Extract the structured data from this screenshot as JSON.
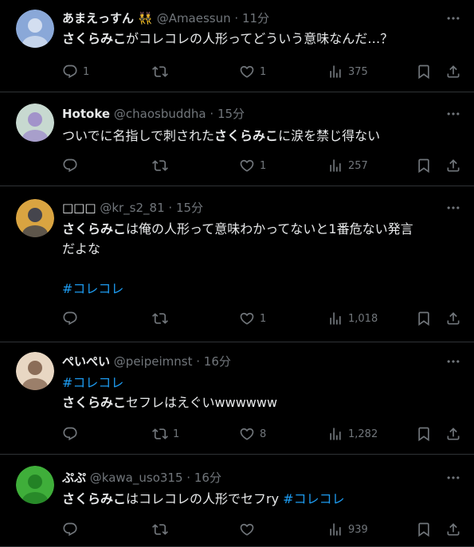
{
  "tweets": [
    {
      "name": "あまえっすん 👯",
      "handle": "@Amaessun",
      "sep": "·",
      "time": "11分",
      "body_parts": [
        {
          "t": "さくらみこ",
          "k": "hl"
        },
        {
          "t": "がコレコレの人形ってどういう意味なんだ…？",
          "k": ""
        }
      ],
      "replies": "1",
      "retweets": "",
      "likes": "1",
      "views": "375",
      "avatar_colors": [
        "#8aa8d8",
        "#dfe8f5"
      ]
    },
    {
      "name": "Hotoke",
      "handle": "@chaosbuddha",
      "sep": "·",
      "time": "15分",
      "body_parts": [
        {
          "t": "ついでに名指しで刺された",
          "k": ""
        },
        {
          "t": "さくらみこ",
          "k": "hl"
        },
        {
          "t": "に涙を禁じ得ない",
          "k": ""
        }
      ],
      "replies": "",
      "retweets": "",
      "likes": "1",
      "views": "257",
      "avatar_colors": [
        "#c7d9d0",
        "#9b86c9"
      ]
    },
    {
      "name": "□□□",
      "handle": "@kr_s2_81",
      "sep": "·",
      "time": "15分",
      "body_parts": [
        {
          "t": "さくらみこ",
          "k": "hl"
        },
        {
          "t": "は俺の人形って意味わかってないと1番危ない発言\nだよな\n\n",
          "k": ""
        },
        {
          "t": "#コレコレ",
          "k": "tag"
        }
      ],
      "replies": "",
      "retweets": "",
      "likes": "1",
      "views": "1,018",
      "avatar_colors": [
        "#d9a441",
        "#2a3550"
      ]
    },
    {
      "name": "ぺいぺい",
      "handle": "@peipeimnst",
      "sep": "·",
      "time": "16分",
      "body_parts": [
        {
          "t": "#コレコレ",
          "k": "tag"
        },
        {
          "t": "\n",
          "k": ""
        },
        {
          "t": "さくらみこ",
          "k": "hl"
        },
        {
          "t": "セフレはえぐいwwwwww",
          "k": ""
        }
      ],
      "replies": "",
      "retweets": "1",
      "likes": "8",
      "views": "1,282",
      "avatar_colors": [
        "#e8d7c3",
        "#7a5a45"
      ]
    },
    {
      "name": "ぷぷ",
      "handle": "@kawa_uso315",
      "sep": "·",
      "time": "16分",
      "body_parts": [
        {
          "t": "さくらみこ",
          "k": "hl"
        },
        {
          "t": "はコレコレの人形でセフry ",
          "k": ""
        },
        {
          "t": "#コレコレ",
          "k": "tag"
        }
      ],
      "replies": "",
      "retweets": "",
      "likes": "",
      "views": "939",
      "avatar_colors": [
        "#3fae3a",
        "#1f7a22"
      ]
    }
  ],
  "icons": {
    "reply": "reply-icon",
    "retweet": "retweet-icon",
    "like": "heart-icon",
    "views": "views-chart-icon",
    "bookmark": "bookmark-icon",
    "share": "share-icon",
    "more": "more-icon"
  },
  "colors": {
    "background": "#000000",
    "text": "#e7e9ea",
    "muted": "#71767b",
    "hashtag": "#1d9bf0",
    "divider": "#2f3336"
  }
}
